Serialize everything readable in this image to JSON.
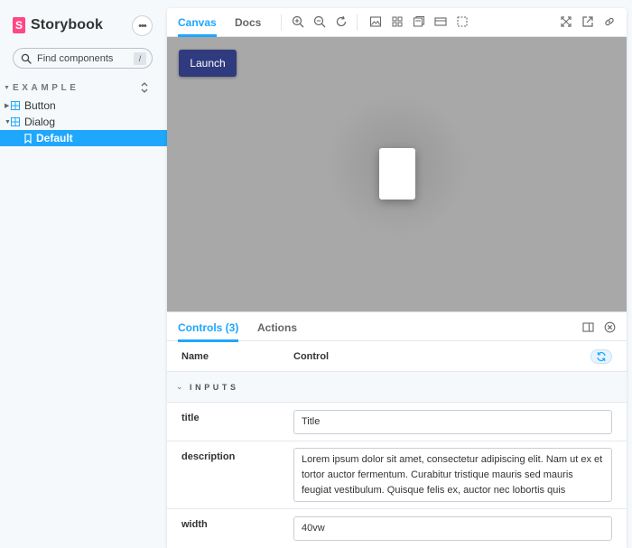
{
  "sidebar": {
    "brand": {
      "logo_letter": "S",
      "name": "Storybook"
    },
    "menu_label": "•••",
    "search": {
      "placeholder": "Find components",
      "value": "",
      "shortcut": "/"
    },
    "group": {
      "label": "EXAMPLE"
    },
    "items": [
      {
        "label": "Button",
        "type": "component",
        "expanded": false
      },
      {
        "label": "Dialog",
        "type": "component",
        "expanded": true
      },
      {
        "label": "Default",
        "type": "story",
        "selected": true
      }
    ],
    "accent_color": "#1ea7fd"
  },
  "toolbar": {
    "tabs": [
      {
        "label": "Canvas",
        "active": true
      },
      {
        "label": "Docs",
        "active": false
      }
    ],
    "icons": [
      "zoom-in-icon",
      "zoom-out-icon",
      "zoom-reset-icon",
      "background-icon",
      "grid-icon",
      "measure-icon",
      "viewport-icon",
      "outline-icon",
      "fullscreen-icon",
      "open-new-tab-icon",
      "copy-link-icon"
    ]
  },
  "canvas": {
    "background": "#a8a8a8",
    "launch_button_label": "Launch",
    "button_color": "#2f3b7e"
  },
  "addons": {
    "tabs": [
      {
        "label": "Controls (3)",
        "active": true
      },
      {
        "label": "Actions",
        "active": false
      }
    ],
    "header": {
      "name": "Name",
      "control": "Control"
    },
    "section_label": "INPUTS",
    "rows": [
      {
        "name": "title",
        "value": "Title"
      },
      {
        "name": "description",
        "value": "Lorem ipsum dolor sit amet, consectetur adipiscing elit. Nam ut ex et tortor auctor fermentum. Curabitur tristique mauris sed mauris feugiat vestibulum. Quisque felis ex, auctor nec lobortis quis"
      },
      {
        "name": "width",
        "value": "40vw"
      }
    ]
  }
}
